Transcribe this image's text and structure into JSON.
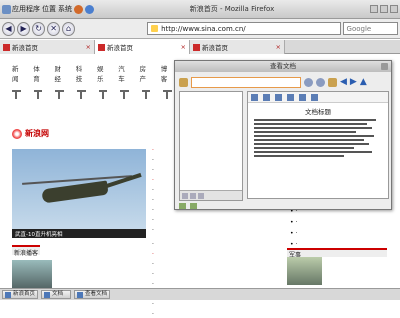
{
  "topbar": {
    "apps": [
      "应用程序",
      "位置",
      "系统"
    ],
    "window_title": "新浪首页 - Mozilla Firefox"
  },
  "navbar": {
    "url": "http://www.sina.com.cn/",
    "search_placeholder": "Google"
  },
  "tabs": [
    {
      "label": "新浪首页"
    },
    {
      "label": "新浪首页"
    },
    {
      "label": "新浪首页"
    }
  ],
  "page": {
    "nav_words": [
      "新闻",
      "体育",
      "财经",
      "科技",
      "娱乐",
      "汽车",
      "房产",
      "博客"
    ],
    "logo": "新浪网",
    "heli_caption": "武直-10直升机亮相",
    "listA": [
      "·",
      "·",
      "·",
      "·",
      "·",
      "·",
      "·",
      "·",
      "·"
    ],
    "listB": [
      "·",
      "·",
      "·",
      "·",
      "·",
      "·",
      "·",
      "·"
    ],
    "right_head": "军事",
    "rightcol": [
      "·",
      "·",
      "·",
      "·",
      "·",
      "·"
    ],
    "bottom_head": "新浪播客"
  },
  "dialog": {
    "title": "查看文档",
    "doc_title": "文档标题"
  },
  "taskbar": [
    "新浪首页",
    "文档",
    "查看文档"
  ]
}
